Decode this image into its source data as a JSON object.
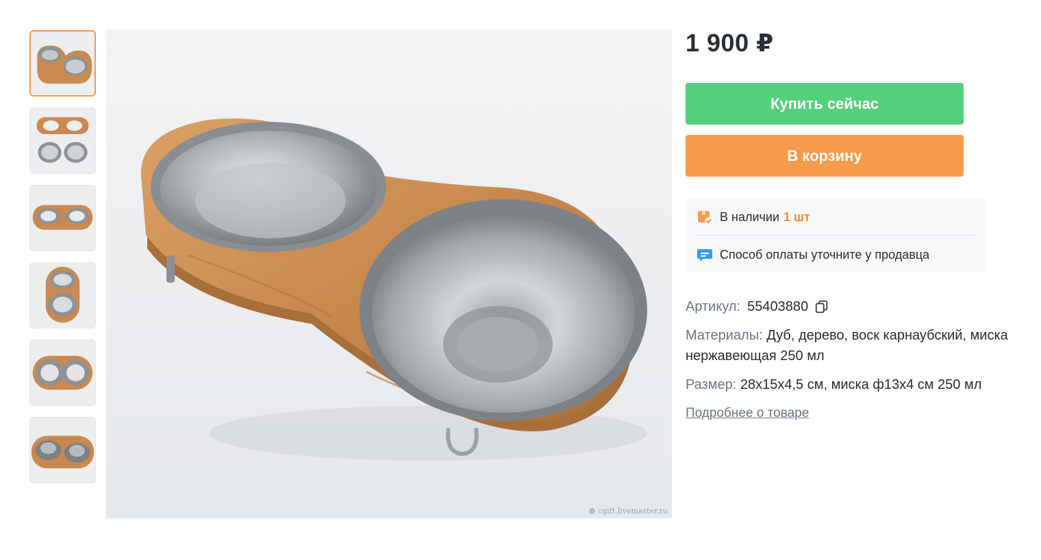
{
  "gallery": {
    "thumbnails": [
      {
        "alt": "thumb-1"
      },
      {
        "alt": "thumb-2"
      },
      {
        "alt": "thumb-3"
      },
      {
        "alt": "thumb-4"
      },
      {
        "alt": "thumb-5"
      },
      {
        "alt": "thumb-6"
      }
    ],
    "watermark": "cgift.livemaster.ru"
  },
  "product": {
    "price": "1 900 ₽",
    "buy_label": "Купить сейчас",
    "cart_label": "В корзину",
    "availability_label": "В наличии",
    "availability_count": "1 шт",
    "payment_text": "Способ оплаты уточните у продавца",
    "sku_label": "Артикул:",
    "sku_value": "55403880",
    "materials_label": "Материалы:",
    "materials_value": "Дуб, дерево, воск карнаубский, миска нержавеющая 250 мл",
    "size_label": "Размер:",
    "size_value": "28х15х4,5 см, миска ф13х4 см 250 мл",
    "more_link": "Подробнее о товаре"
  },
  "colors": {
    "buy_button": "#55cf7b",
    "cart_button": "#f79a4b",
    "accent_orange": "#f08c2e",
    "chat_icon_blue": "#3b9cf0"
  },
  "icons": {
    "availability": "box-check-icon",
    "payment": "chat-bubble-icon",
    "copy": "copy-icon"
  }
}
